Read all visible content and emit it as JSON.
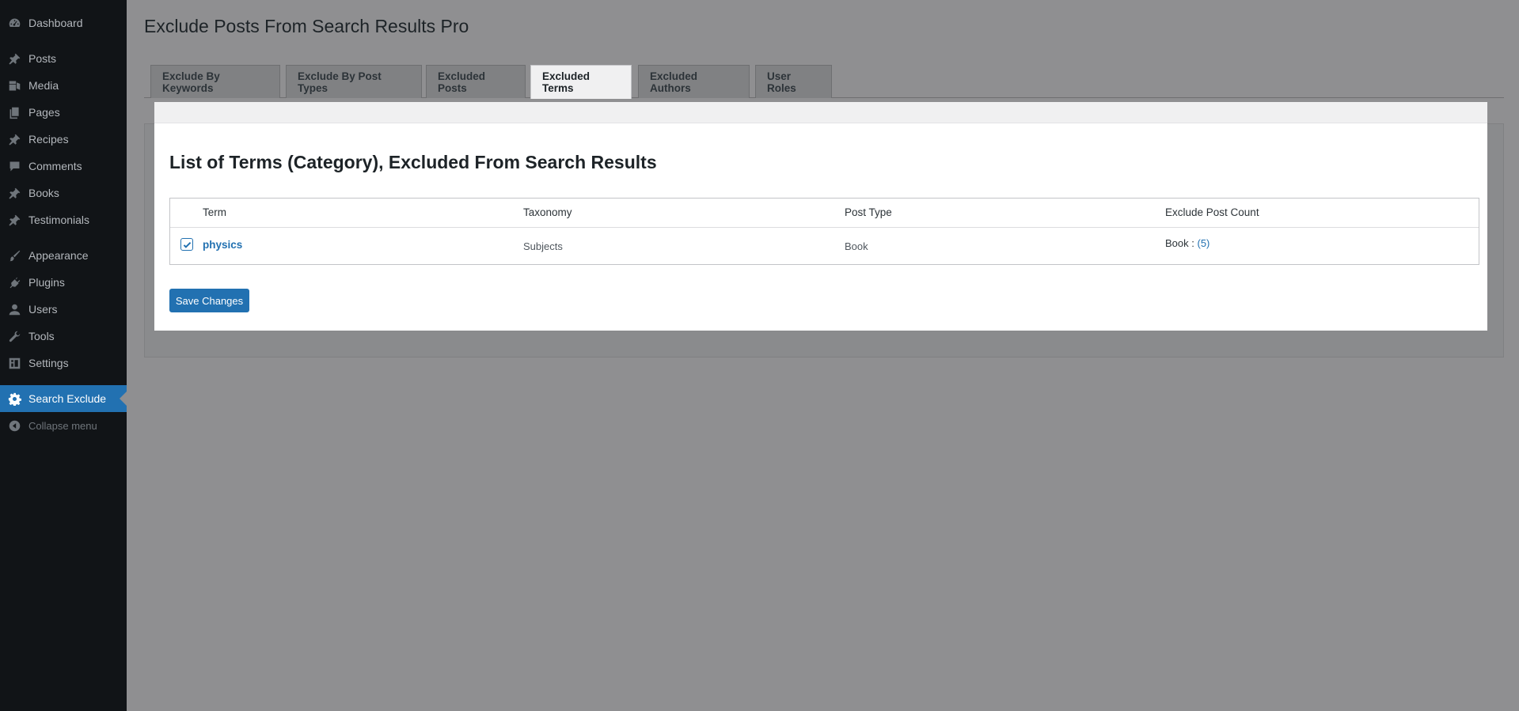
{
  "sidebar": {
    "items": [
      {
        "label": "Dashboard",
        "icon": "dashboard-icon"
      },
      {
        "label": "Posts",
        "icon": "pin-icon"
      },
      {
        "label": "Media",
        "icon": "media-icon"
      },
      {
        "label": "Pages",
        "icon": "pages-icon"
      },
      {
        "label": "Recipes",
        "icon": "pin-icon"
      },
      {
        "label": "Comments",
        "icon": "comment-icon"
      },
      {
        "label": "Books",
        "icon": "pin-icon"
      },
      {
        "label": "Testimonials",
        "icon": "pin-icon"
      },
      {
        "label": "Appearance",
        "icon": "brush-icon"
      },
      {
        "label": "Plugins",
        "icon": "plug-icon"
      },
      {
        "label": "Users",
        "icon": "user-icon"
      },
      {
        "label": "Tools",
        "icon": "wrench-icon"
      },
      {
        "label": "Settings",
        "icon": "settings-icon"
      },
      {
        "label": "Search Exclude",
        "icon": "gear-icon",
        "active": true
      },
      {
        "label": "Collapse menu",
        "icon": "collapse-icon"
      }
    ]
  },
  "page": {
    "title": "Exclude Posts From Search Results Pro"
  },
  "tabs": [
    {
      "label": "Exclude By Keywords"
    },
    {
      "label": "Exclude By Post Types"
    },
    {
      "label": "Excluded Posts"
    },
    {
      "label": "Excluded Terms",
      "active": true
    },
    {
      "label": "Excluded Authors"
    },
    {
      "label": "User Roles"
    }
  ],
  "section": {
    "heading": "List of Terms (Category), Excluded From Search Results"
  },
  "table": {
    "columns": [
      "Term",
      "Taxonomy",
      "Post Type",
      "Exclude Post Count"
    ],
    "rows": [
      {
        "checked": true,
        "term": "physics",
        "taxonomy": "Subjects",
        "post_type": "Book",
        "count_label": "Book :",
        "count": "(5)"
      }
    ]
  },
  "actions": {
    "save_label": "Save Changes"
  },
  "colors": {
    "accent": "#2271b1",
    "sidebar_bg": "#111417",
    "overlay_bg": "#8f8f91"
  }
}
